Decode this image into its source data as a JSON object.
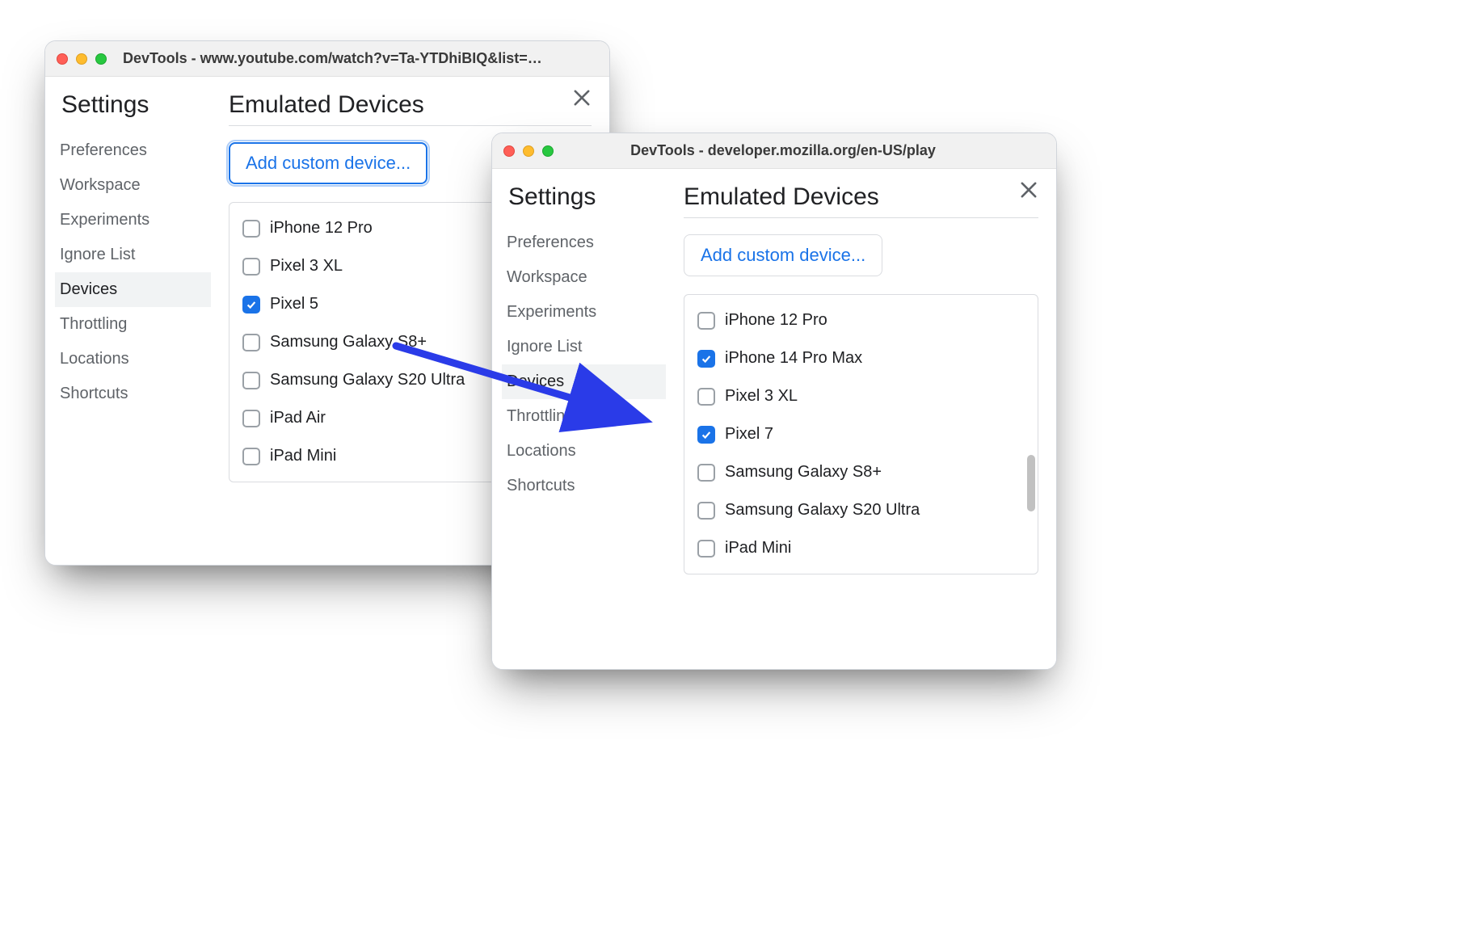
{
  "window1": {
    "title": "DevTools - www.youtube.com/watch?v=Ta-YTDhiBIQ&list=PL...",
    "settings_label": "Settings",
    "nav": [
      "Preferences",
      "Workspace",
      "Experiments",
      "Ignore List",
      "Devices",
      "Throttling",
      "Locations",
      "Shortcuts"
    ],
    "selected_nav": "Devices",
    "main_heading": "Emulated Devices",
    "add_custom_label": "Add custom device...",
    "devices": [
      {
        "label": "iPhone 12 Pro",
        "checked": false
      },
      {
        "label": "Pixel 3 XL",
        "checked": false
      },
      {
        "label": "Pixel 5",
        "checked": true
      },
      {
        "label": "Samsung Galaxy S8+",
        "checked": false
      },
      {
        "label": "Samsung Galaxy S20 Ultra",
        "checked": false
      },
      {
        "label": "iPad Air",
        "checked": false
      },
      {
        "label": "iPad Mini",
        "checked": false
      }
    ]
  },
  "window2": {
    "title": "DevTools - developer.mozilla.org/en-US/play",
    "settings_label": "Settings",
    "nav": [
      "Preferences",
      "Workspace",
      "Experiments",
      "Ignore List",
      "Devices",
      "Throttling",
      "Locations",
      "Shortcuts"
    ],
    "selected_nav": "Devices",
    "main_heading": "Emulated Devices",
    "add_custom_label": "Add custom device...",
    "devices": [
      {
        "label": "iPhone 12 Pro",
        "checked": false
      },
      {
        "label": "iPhone 14 Pro Max",
        "checked": true
      },
      {
        "label": "Pixel 3 XL",
        "checked": false
      },
      {
        "label": "Pixel 7",
        "checked": true
      },
      {
        "label": "Samsung Galaxy S8+",
        "checked": false
      },
      {
        "label": "Samsung Galaxy S20 Ultra",
        "checked": false
      },
      {
        "label": "iPad Mini",
        "checked": false
      }
    ]
  }
}
